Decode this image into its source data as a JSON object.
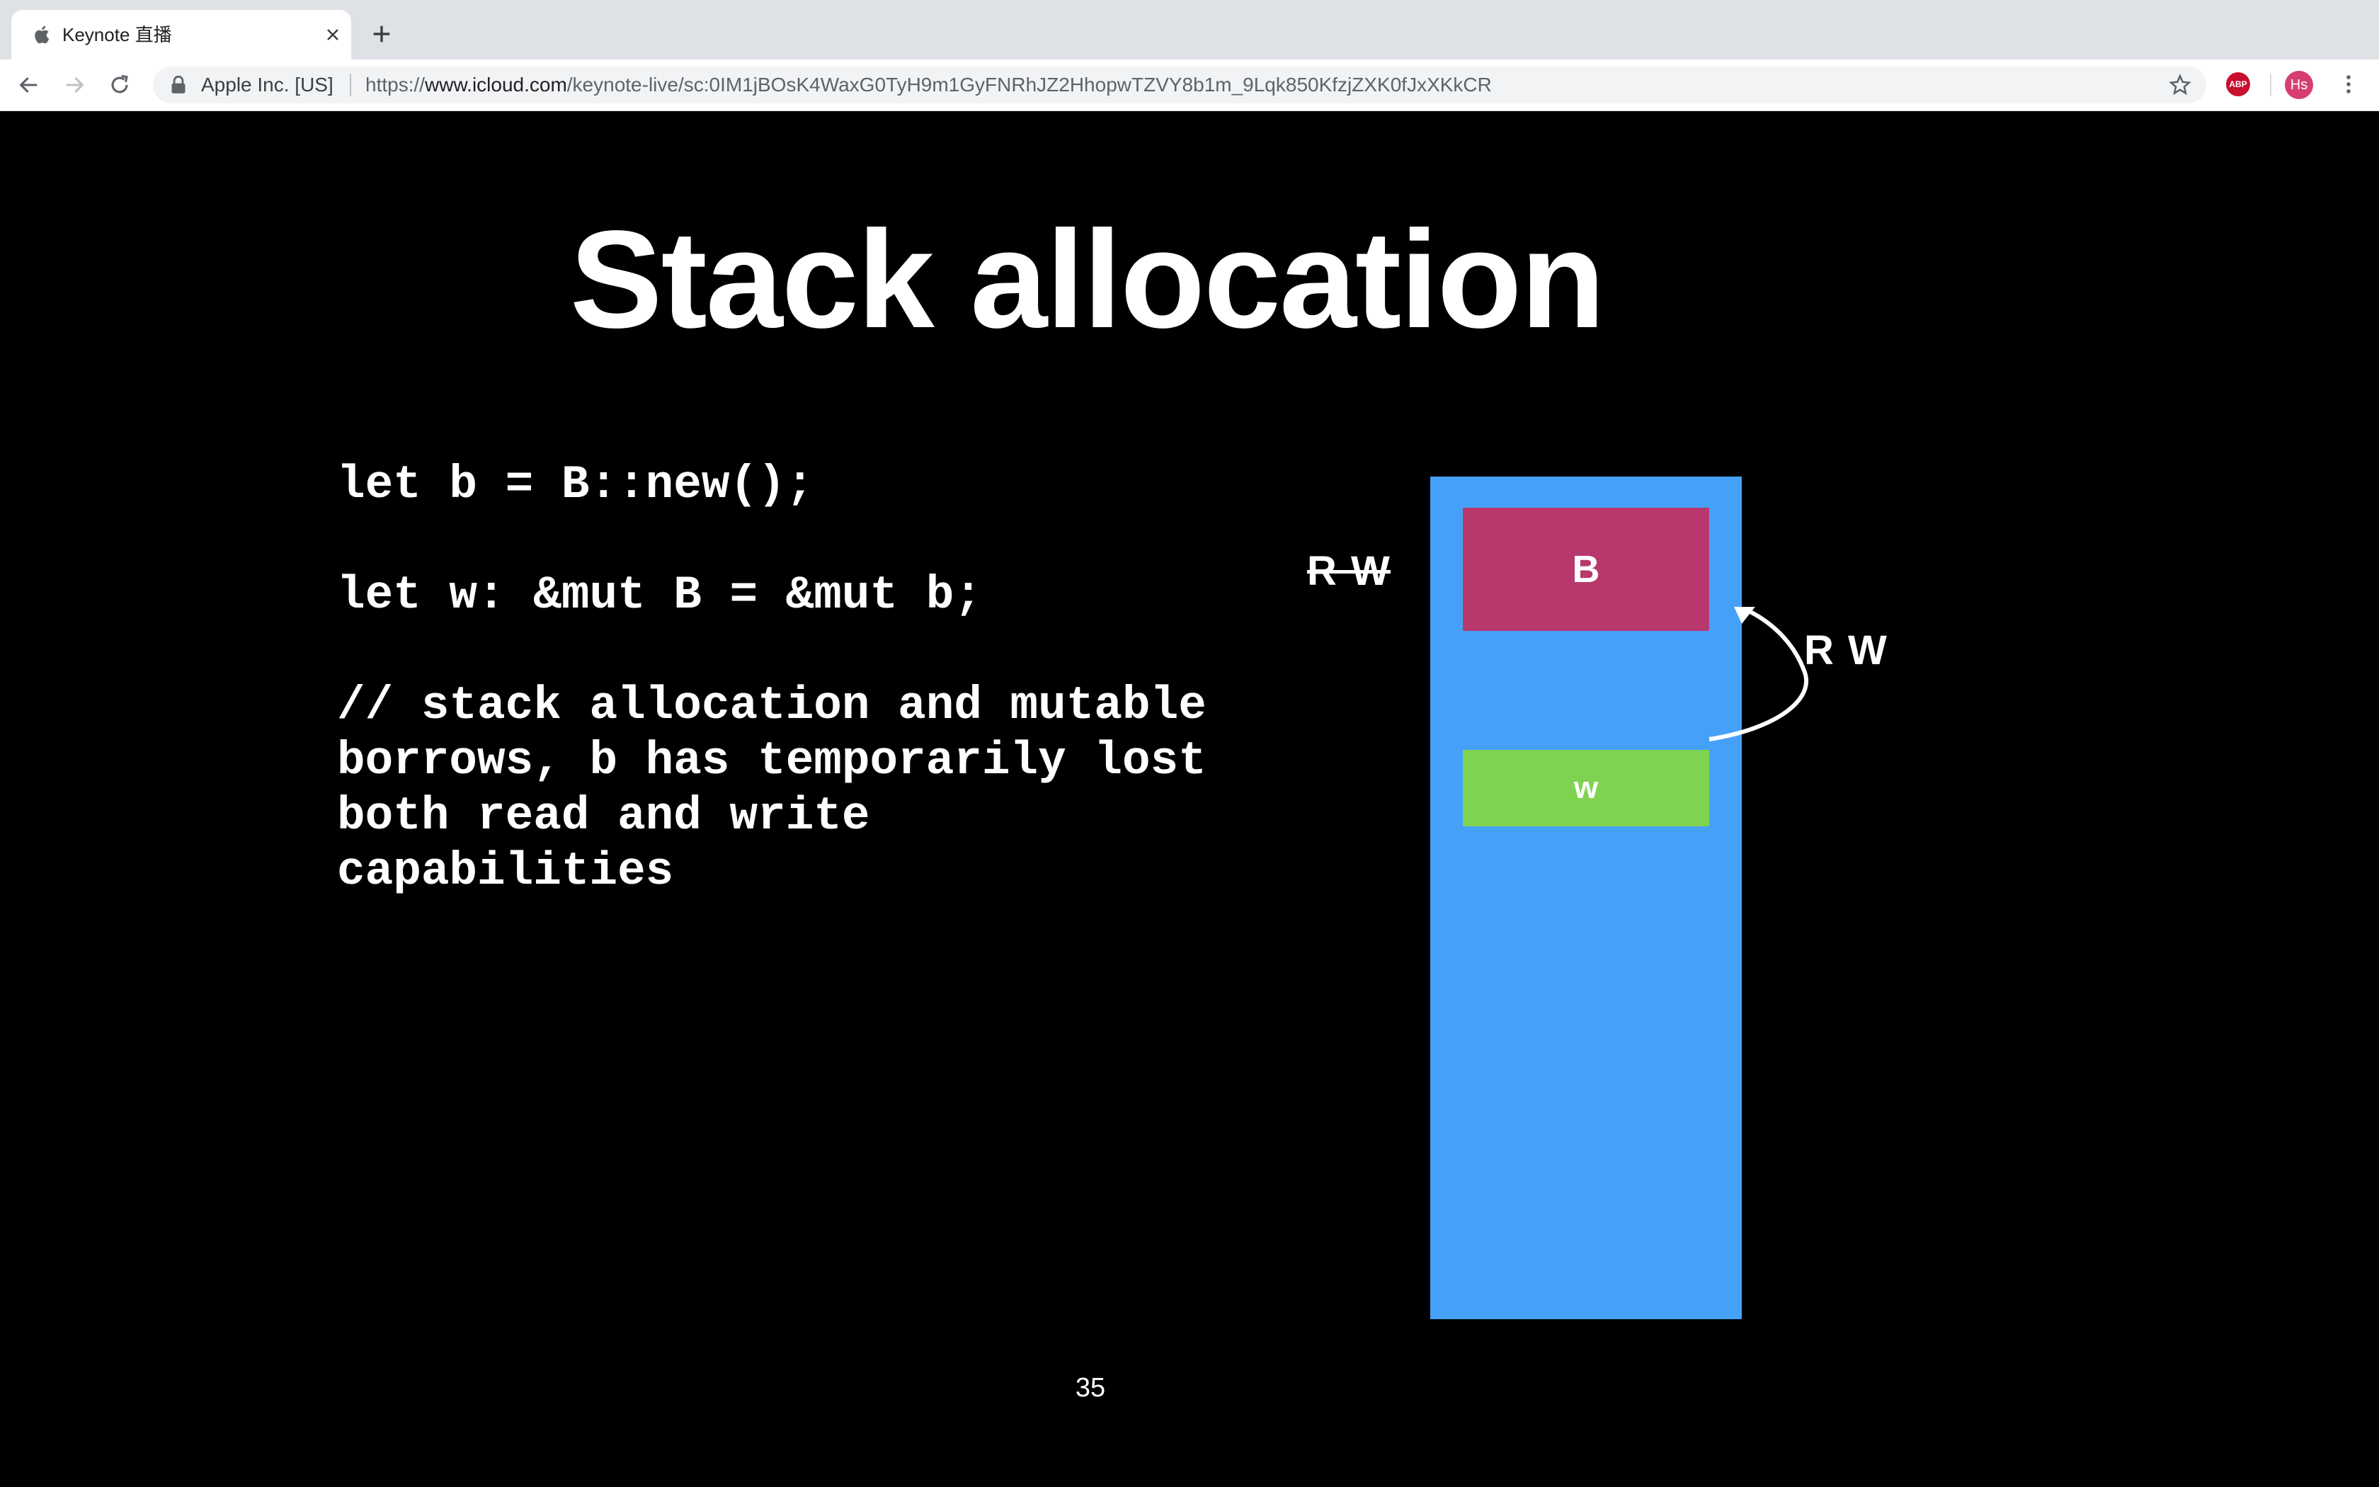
{
  "browser": {
    "tab": {
      "title": "Keynote 直播",
      "favicon": "apple-icon"
    },
    "omnibox": {
      "site_identity": "Apple Inc. [US]",
      "url_prefix": "https://",
      "url_host": "www.icloud.com",
      "url_path": "/keynote-live/sc:0IM1jBOsK4WaxG0TyH9m1GyFNRhJZ2HhopwTZVY8b1m_9Lqk850KfzjZXK0fJxXKkCR"
    },
    "extensions": {
      "abp_label": "ABP",
      "avatar_initials": "Hs"
    },
    "icons": [
      "back-icon",
      "forward-icon",
      "reload-icon",
      "lock-icon",
      "star-icon",
      "close-icon",
      "plus-icon",
      "menu-icon"
    ]
  },
  "slide": {
    "title": "Stack allocation",
    "code_line_1": "let b = B::new();",
    "code_line_2": "let w: &mut B = &mut b;",
    "comment": "// stack allocation and mutable\nborrows, b has temporarily lost\nboth read and write\ncapabilities",
    "diagram": {
      "box_b_label": "B",
      "box_w_label": "w",
      "struck_permissions": "R W",
      "borrow_permissions": "R W",
      "colors": {
        "stack": "#45a1f7",
        "box_b": "#b8386e",
        "box_w": "#80d350"
      }
    },
    "page_number": "35"
  }
}
